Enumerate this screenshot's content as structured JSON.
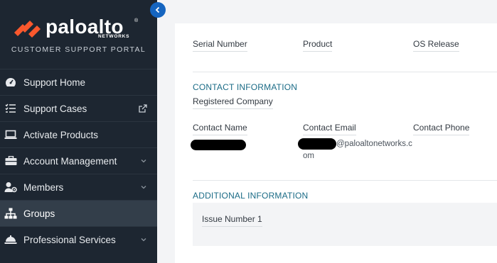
{
  "brand": {
    "logo_text": "paloalto",
    "logo_reg": "®",
    "logo_sub": "NETWORKS",
    "portal_title": "CUSTOMER SUPPORT PORTAL"
  },
  "sidebar": {
    "items": [
      {
        "label": "Support Home",
        "icon": "dashboard-icon"
      },
      {
        "label": "Support Cases",
        "icon": "list-icon",
        "external": true
      },
      {
        "label": "Activate Products",
        "icon": "laptop-icon"
      },
      {
        "label": "Account Management",
        "icon": "briefcase-icon",
        "expandable": true
      },
      {
        "label": "Members",
        "icon": "user-gear-icon",
        "expandable": true
      },
      {
        "label": "Groups",
        "icon": "sitemap-icon",
        "active": true
      },
      {
        "label": "Professional Services",
        "icon": "bell-service-icon",
        "expandable": true
      }
    ]
  },
  "main": {
    "device": {
      "serial_number_label": "Serial Number",
      "product_label": "Product",
      "os_release_label": "OS Release"
    },
    "contact": {
      "title": "CONTACT INFORMATION",
      "registered_company_label": "Registered Company",
      "contact_name_label": "Contact Name",
      "contact_email_label": "Contact Email",
      "contact_phone_label": "Contact Phone",
      "contact_email_value_line1": "@paloaltonetworks.c",
      "contact_email_value_line2": "om"
    },
    "additional": {
      "title": "ADDITIONAL INFORMATION",
      "issue_number_label": "Issue Number 1"
    }
  },
  "colors": {
    "sidebar_bg": "#1d2631",
    "active_bg": "#333e4a",
    "accent": "#1565c0",
    "logo_orange": "#fa582d",
    "section_title": "#1a6b86"
  }
}
